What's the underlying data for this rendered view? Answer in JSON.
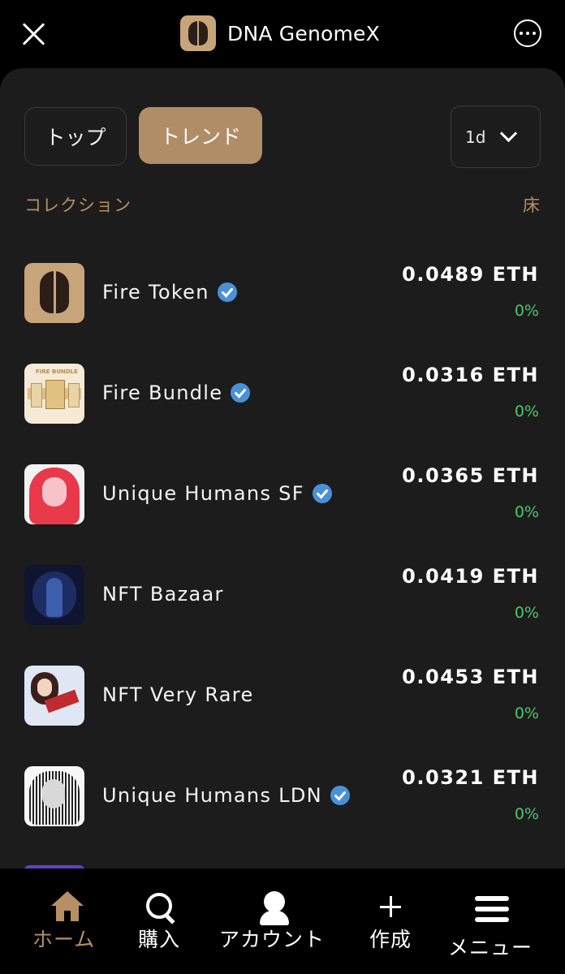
{
  "app": {
    "title": "DNA GenomeX"
  },
  "tabs": [
    {
      "label": "トップ"
    },
    {
      "label": "トレンド",
      "active": true
    }
  ],
  "period": {
    "value": "1d"
  },
  "list_header": {
    "collection_label": "コレクション",
    "floor_label": "床"
  },
  "collections": [
    {
      "name": "Fire Token",
      "verified": true,
      "floor": "0.0489 ETH",
      "change": "0%",
      "thumb": "bearded-face-split-icon"
    },
    {
      "name": "Fire Bundle",
      "verified": true,
      "floor": "0.0316 ETH",
      "change": "0%",
      "thumb": "fire-bundle-cards"
    },
    {
      "name": "Unique Humans SF",
      "verified": true,
      "floor": "0.0365 ETH",
      "change": "0%",
      "thumb": "red-ascii-portrait"
    },
    {
      "name": "NFT Bazaar",
      "verified": false,
      "floor": "0.0419 ETH",
      "change": "0%",
      "thumb": "blue-robot-figure"
    },
    {
      "name": "NFT Very Rare",
      "verified": false,
      "floor": "0.0453 ETH",
      "change": "0%",
      "thumb": "anime-girl-flying"
    },
    {
      "name": "Unique Humans LDN",
      "verified": true,
      "floor": "0.0321 ETH",
      "change": "0%",
      "thumb": "bw-ascii-portrait"
    }
  ],
  "thumb_texts": {
    "bundle_label": "FIRE BUNDLE"
  },
  "bottom_nav": [
    {
      "label": "ホーム",
      "icon": "home-icon",
      "active": true
    },
    {
      "label": "購入",
      "icon": "search-icon"
    },
    {
      "label": "アカウント",
      "icon": "user-icon"
    },
    {
      "label": "作成",
      "icon": "plus-icon"
    },
    {
      "label": "メニュー",
      "icon": "menu-icon"
    }
  ],
  "colors": {
    "accent": "#b08d67",
    "positive": "#4cc86a",
    "verified": "#4a90d9",
    "panel": "#1c1c1c"
  }
}
